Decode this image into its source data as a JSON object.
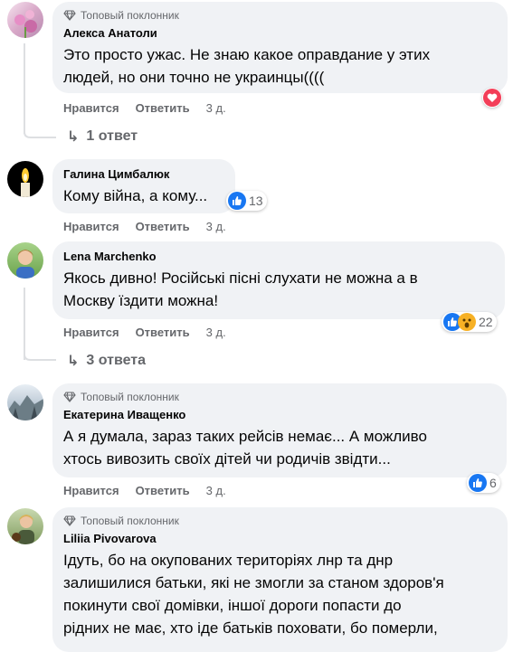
{
  "badge_label": "Топовый поклонник",
  "actions": {
    "like": "Нравится",
    "reply": "Ответить"
  },
  "comments": [
    {
      "name": "Алекса Анатоли",
      "text_lines": [
        "Это просто ужас. Не знаю какое оправдание у этих",
        "людей, но они точно не украинцы(((("
      ],
      "time": "3 д.",
      "replies": "1 ответ"
    },
    {
      "name": "Галина Цимбалюк",
      "text_lines": [
        "Кому війна, а кому..."
      ],
      "time": "3 д.",
      "reactions": "13"
    },
    {
      "name": "Lena Marchenko",
      "text_lines": [
        "Якось дивно! Російські пісні слухати не можна а в",
        "Москву їздити можна!"
      ],
      "time": "3 д.",
      "reactions": "22",
      "replies": "3 ответа"
    },
    {
      "name": "Екатерина Иващенко",
      "text_lines": [
        "А я думала, зараз таких рейсів немає... А можливо",
        "хтось вивозить своїх дітей чи родичів звідти..."
      ],
      "time": "3 д.",
      "reactions": "6"
    },
    {
      "name": "Liliia Pivovarova",
      "text_lines": [
        "Ідуть, бо на окупованих територіях лнр та днр",
        "залишилися батьки, які не змогли за станом здоров'я",
        "покинути свої домівки, іншої дороги попасти до",
        "рідних не має, хто іде батьків поховати, бо померли,"
      ]
    }
  ],
  "colors": {
    "like_blue": "#1877f2",
    "love_red": "#f33e58",
    "bubble": "#f0f2f5",
    "muted": "#65676b"
  }
}
